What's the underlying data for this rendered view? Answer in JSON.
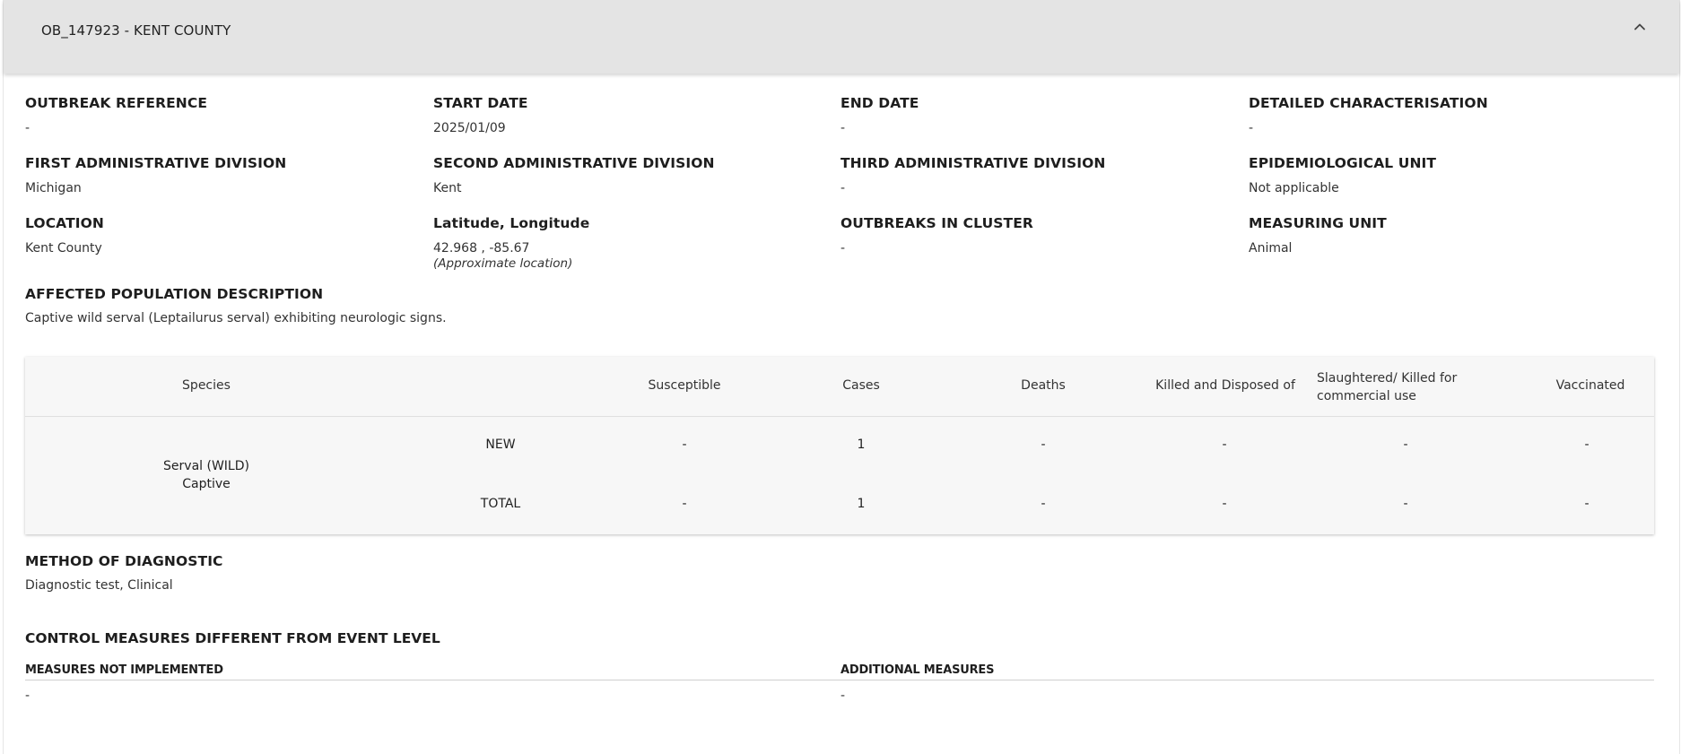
{
  "header": {
    "title": "OB_147923 - KENT COUNTY"
  },
  "fields": {
    "outbreak_reference": {
      "label": "OUTBREAK REFERENCE",
      "value": "-"
    },
    "start_date": {
      "label": "START DATE",
      "value": "2025/01/09"
    },
    "end_date": {
      "label": "END DATE",
      "value": "-"
    },
    "detailed_characterisation": {
      "label": "DETAILED CHARACTERISATION",
      "value": "-"
    },
    "first_admin_division": {
      "label": "FIRST ADMINISTRATIVE DIVISION",
      "value": "Michigan"
    },
    "second_admin_division": {
      "label": "SECOND ADMINISTRATIVE DIVISION",
      "value": "Kent"
    },
    "third_admin_division": {
      "label": "THIRD ADMINISTRATIVE DIVISION",
      "value": "-"
    },
    "epidemiological_unit": {
      "label": "EPIDEMIOLOGICAL UNIT",
      "value": "Not applicable"
    },
    "location": {
      "label": "LOCATION",
      "value": "Kent County"
    },
    "lat_long": {
      "label": "Latitude, Longitude",
      "value": "42.968 , -85.67",
      "note": "(Approximate location)"
    },
    "outbreaks_in_cluster": {
      "label": "OUTBREAKS IN CLUSTER",
      "value": "-"
    },
    "measuring_unit": {
      "label": "MEASURING UNIT",
      "value": "Animal"
    }
  },
  "affected_population": {
    "label": "AFFECTED POPULATION DESCRIPTION",
    "value": "Captive wild serval (Leptailurus serval) exhibiting neurologic signs."
  },
  "table": {
    "headers": {
      "species": "Species",
      "susceptible": "Susceptible",
      "cases": "Cases",
      "deaths": "Deaths",
      "killed_disposed": "Killed and Disposed of",
      "slaughtered_line1": "Slaughtered/ Killed for",
      "slaughtered_line2": "commercial use",
      "vaccinated": "Vaccinated"
    },
    "species_line1": "Serval (WILD)",
    "species_line2": "Captive",
    "rows": [
      {
        "type": "NEW",
        "susceptible": "-",
        "cases": "1",
        "deaths": "-",
        "killed_disposed": "-",
        "slaughtered": "-",
        "vaccinated": "-"
      },
      {
        "type": "TOTAL",
        "susceptible": "-",
        "cases": "1",
        "deaths": "-",
        "killed_disposed": "-",
        "slaughtered": "-",
        "vaccinated": "-"
      }
    ]
  },
  "method_of_diagnostic": {
    "label": "METHOD OF DIAGNOSTIC",
    "value": "Diagnostic test, Clinical"
  },
  "control_measures": {
    "label": "CONTROL MEASURES DIFFERENT FROM EVENT LEVEL",
    "not_implemented_label": "MEASURES NOT IMPLEMENTED",
    "not_implemented_value": "-",
    "additional_label": "ADDITIONAL MEASURES",
    "additional_value": "-"
  }
}
